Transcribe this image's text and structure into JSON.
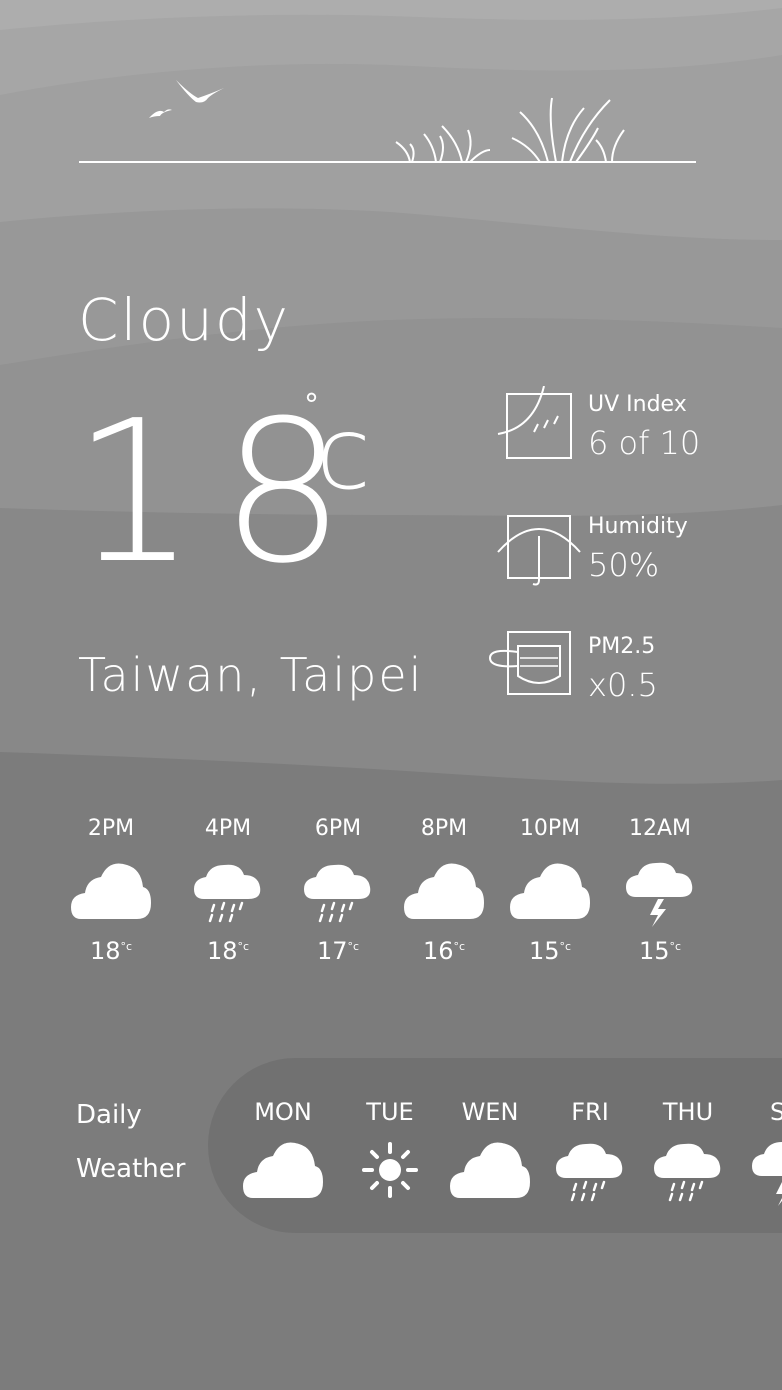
{
  "current": {
    "condition": "Cloudy",
    "temperature": "18",
    "degree_symbol": "°",
    "unit": "c",
    "location": "Taiwan, Taipei"
  },
  "stats": [
    {
      "label": "UV Index",
      "value": "6 of 10",
      "icon": "uv-icon"
    },
    {
      "label": "Humidity",
      "value": "50%",
      "icon": "humidity-umbrella-icon"
    },
    {
      "label": "PM2.5",
      "value": "x0.5",
      "icon": "mask-icon"
    }
  ],
  "hourly": [
    {
      "time": "2PM",
      "icon": "cloud-icon",
      "temp": "18",
      "unit": "°c"
    },
    {
      "time": "4PM",
      "icon": "rain-icon",
      "temp": "18",
      "unit": "°c"
    },
    {
      "time": "6PM",
      "icon": "rain-icon",
      "temp": "17",
      "unit": "°c"
    },
    {
      "time": "8PM",
      "icon": "cloud-icon",
      "temp": "16",
      "unit": "°c"
    },
    {
      "time": "10PM",
      "icon": "cloud-icon",
      "temp": "15",
      "unit": "°c"
    },
    {
      "time": "12AM",
      "icon": "thunder-icon",
      "temp": "15",
      "unit": "°c"
    }
  ],
  "daily": {
    "label_line1": "Daily",
    "label_line2": "Weather",
    "days": [
      {
        "name": "MON",
        "icon": "cloud-icon"
      },
      {
        "name": "TUE",
        "icon": "sun-icon"
      },
      {
        "name": "WEN",
        "icon": "cloud-icon"
      },
      {
        "name": "FRI",
        "icon": "rain-icon"
      },
      {
        "name": "THU",
        "icon": "rain-icon"
      },
      {
        "name": "SA",
        "icon": "thunder-icon"
      }
    ]
  },
  "colors": {
    "text": "#ffffff",
    "band_light": "#a9a9a9",
    "band_dark": "#7c7c7c",
    "pill": "#717171"
  }
}
